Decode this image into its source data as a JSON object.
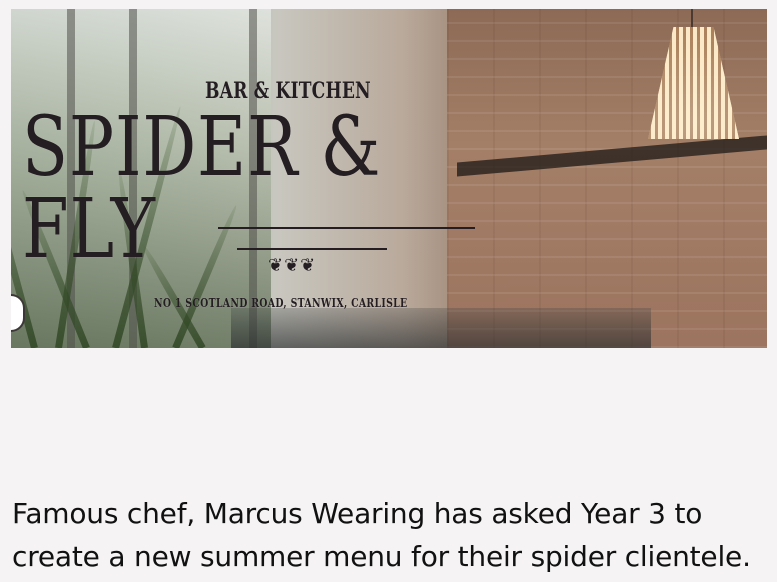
{
  "hero_image": {
    "alt": "Spider & Fly bar and kitchen interior",
    "logo": {
      "top_text": "BAR & KITCHEN",
      "name": "SPIDER & FLY",
      "address": "NO 1 SCOTLAND ROAD, STANWIX, CARLISLE",
      "ornament": "❦❦❦"
    }
  },
  "caption": {
    "line_1": "Famous chef, Marcus Wearing has asked Year 3 to",
    "line_2": "create a new summer menu for their spider clientele."
  },
  "colors": {
    "background": "#f5f3f3",
    "text": "#111111",
    "logo_ink": "#241d22"
  }
}
